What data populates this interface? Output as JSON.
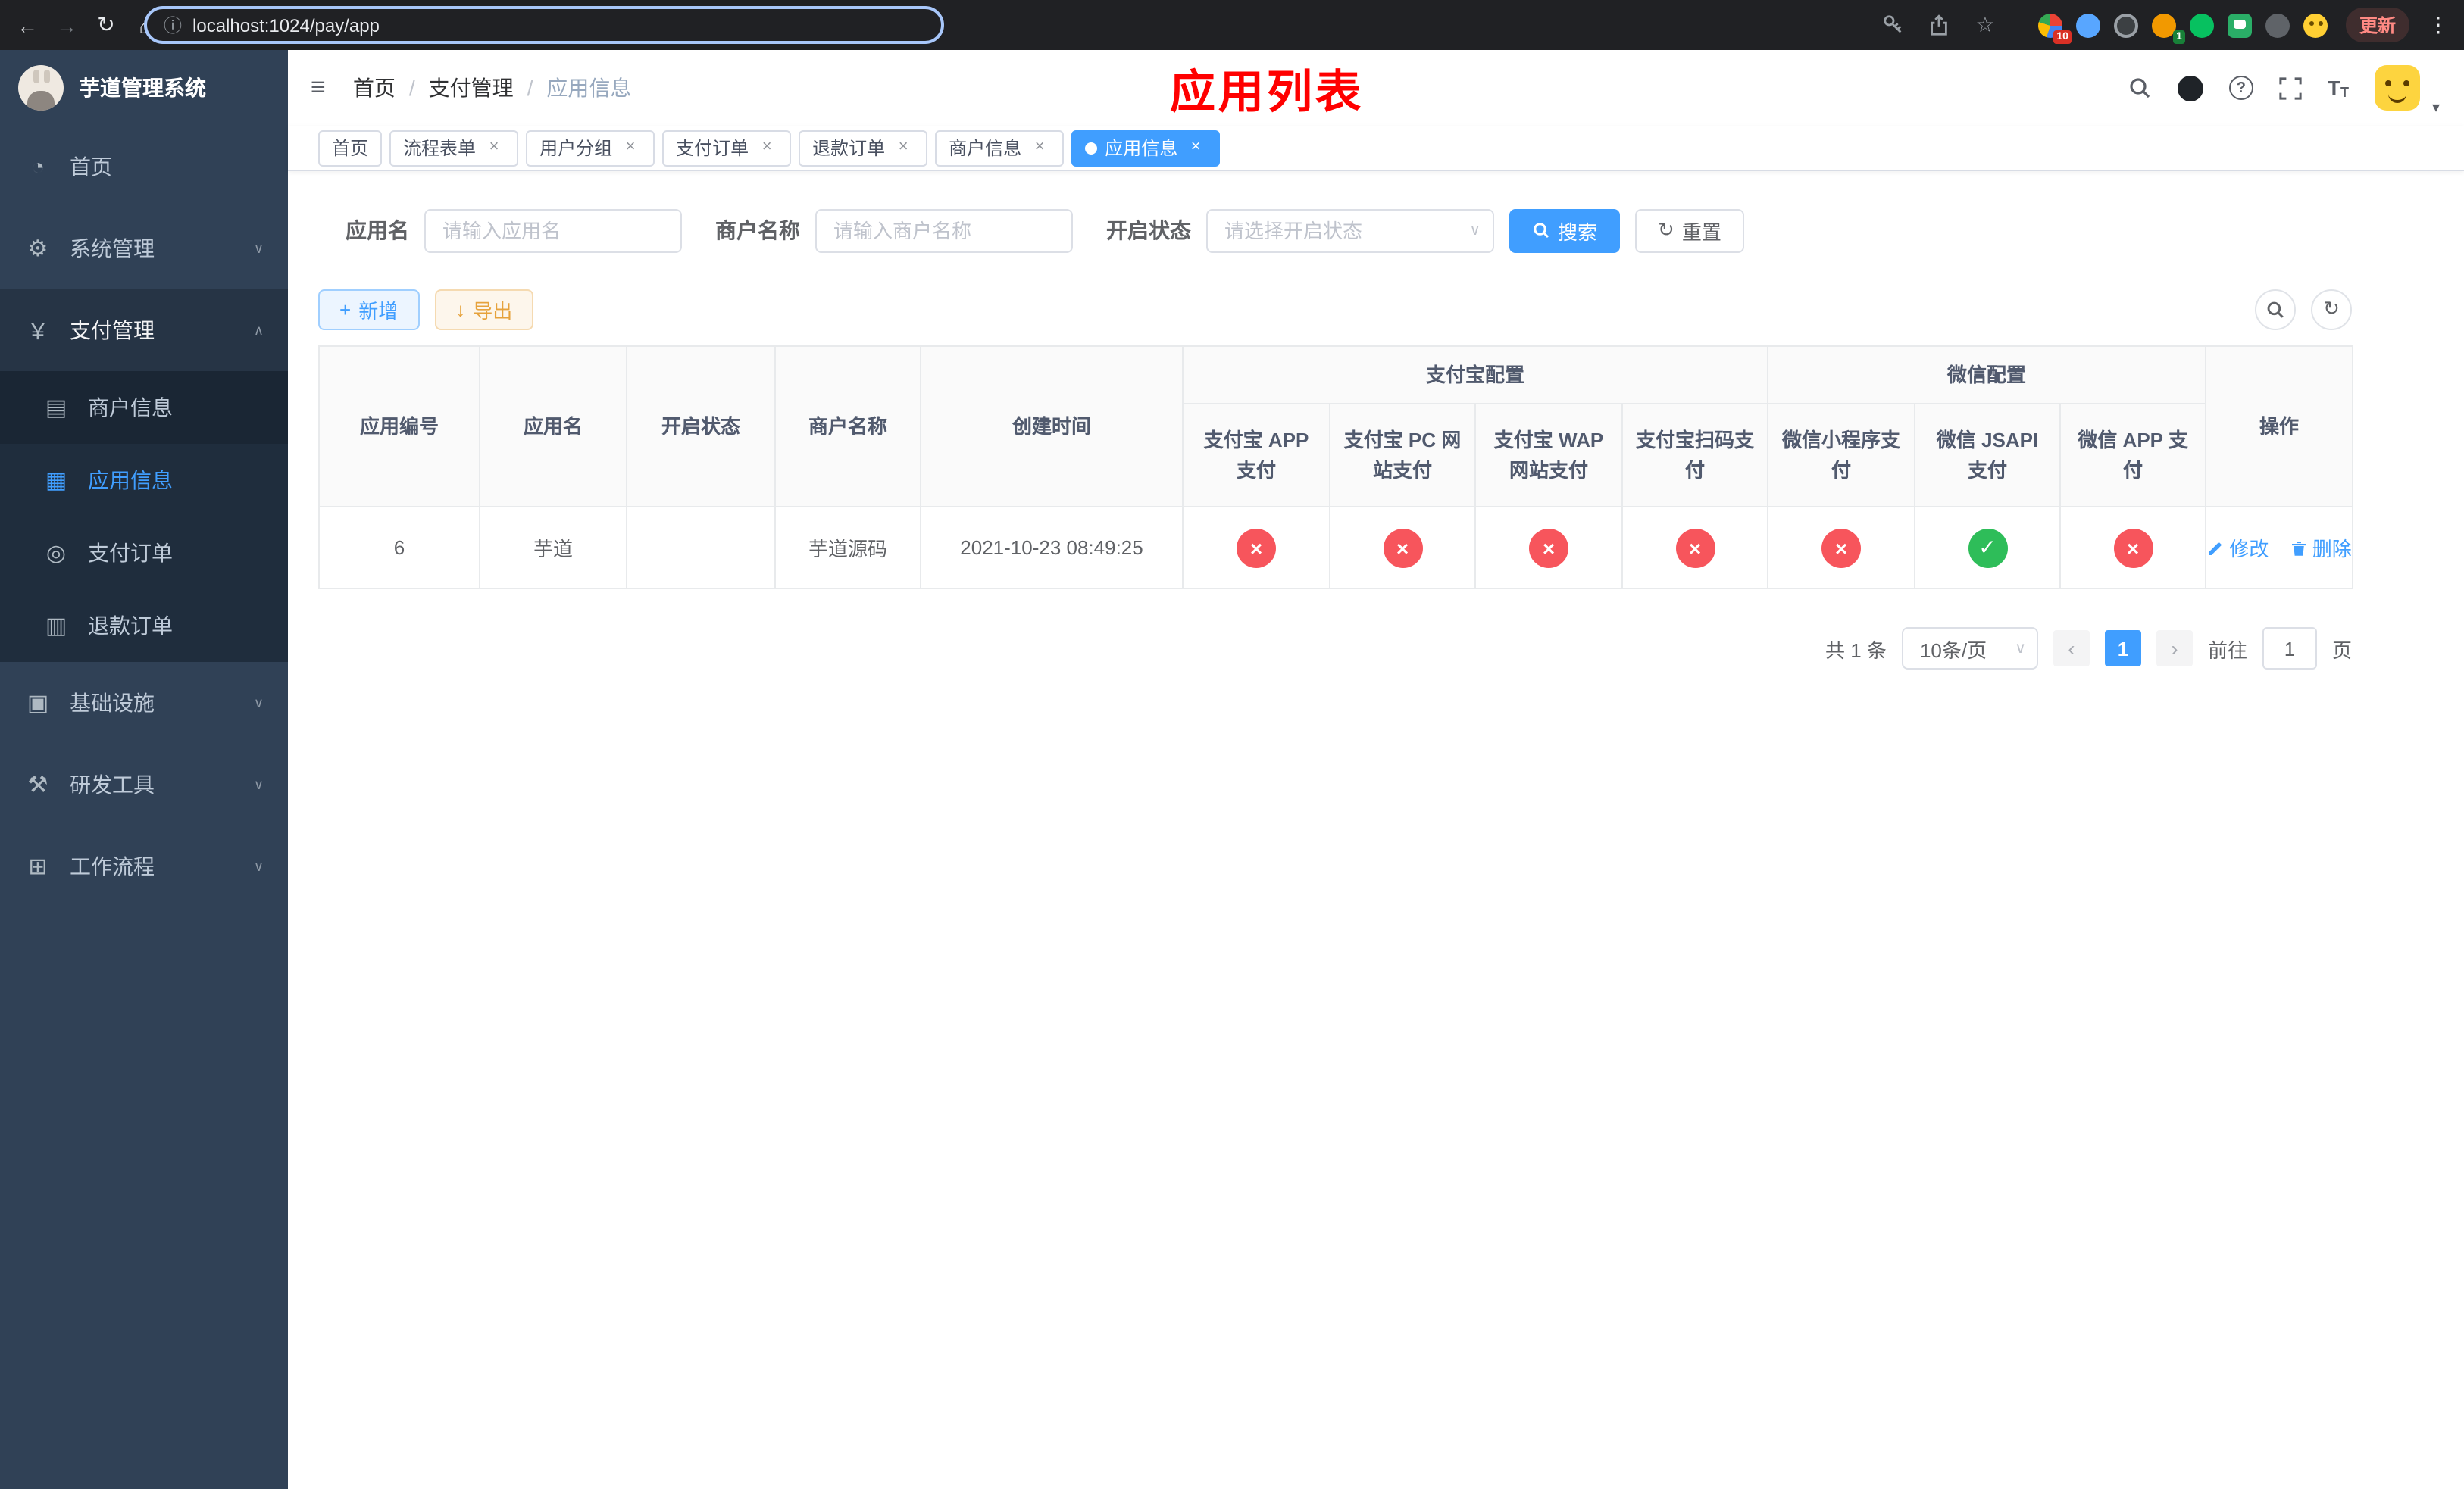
{
  "browser": {
    "url": "localhost:1024/pay/app",
    "update_label": "更新",
    "ext_badge_1": "10",
    "ext_badge_2": "1"
  },
  "icons": {
    "back": "←",
    "forward": "→",
    "reload": "↻",
    "home": "⌂",
    "info": "ⓘ",
    "star": "☆",
    "kebab": "⋮",
    "hamburger": "≡",
    "dashboard": "◔",
    "gear": "⚙",
    "yen": "￥",
    "card": "▤",
    "grid": "▦",
    "order": "◎",
    "doc": "▥",
    "infra": "▣",
    "tools": "⚒",
    "flow": "⊞",
    "chev_down": "∨",
    "chev_up": "∧",
    "caret_down": "▾",
    "plus": "+",
    "download": "↓",
    "refresh": "↻",
    "close": "×"
  },
  "sidebar": {
    "title": "芋道管理系统",
    "items": [
      {
        "label": "首页"
      },
      {
        "label": "系统管理"
      },
      {
        "label": "支付管理"
      },
      {
        "label": "商户信息"
      },
      {
        "label": "应用信息"
      },
      {
        "label": "支付订单"
      },
      {
        "label": "退款订单"
      },
      {
        "label": "基础设施"
      },
      {
        "label": "研发工具"
      },
      {
        "label": "工作流程"
      }
    ]
  },
  "header": {
    "breadcrumb": {
      "home": "首页",
      "section": "支付管理",
      "current": "应用信息"
    },
    "page_title": "应用列表"
  },
  "tabs": [
    {
      "label": "首页"
    },
    {
      "label": "流程表单"
    },
    {
      "label": "用户分组"
    },
    {
      "label": "支付订单"
    },
    {
      "label": "退款订单"
    },
    {
      "label": "商户信息"
    },
    {
      "label": "应用信息"
    }
  ],
  "filters": {
    "app_name_label": "应用名",
    "app_name_placeholder": "请输入应用名",
    "merchant_label": "商户名称",
    "merchant_placeholder": "请输入商户名称",
    "status_label": "开启状态",
    "status_placeholder": "请选择开启状态",
    "search_label": "搜索",
    "reset_label": "重置"
  },
  "toolbar": {
    "add_label": "新增",
    "export_label": "导出"
  },
  "table": {
    "columns": {
      "id": "应用编号",
      "name": "应用名",
      "status": "开启状态",
      "merchant": "商户名称",
      "created": "创建时间",
      "alipay_group": "支付宝配置",
      "wechat_group": "微信配置",
      "alipay_app": "支付宝 APP 支付",
      "alipay_pc": "支付宝 PC 网站支付",
      "alipay_wap": "支付宝 WAP 网站支付",
      "alipay_qr": "支付宝扫码支付",
      "wx_mini": "微信小程序支付",
      "wx_jsapi": "微信 JSAPI 支付",
      "wx_app": "微信 APP 支付",
      "ops": "操作"
    },
    "row": {
      "id": "6",
      "name": "芋道",
      "enabled": "true",
      "merchant": "芋道源码",
      "created": "2021-10-23 08:49:25",
      "configs": [
        {
          "state": "off",
          "glyph": "×"
        },
        {
          "state": "off",
          "glyph": "×"
        },
        {
          "state": "off",
          "glyph": "×"
        },
        {
          "state": "off",
          "glyph": "×"
        },
        {
          "state": "off",
          "glyph": "×"
        },
        {
          "state": "on",
          "glyph": "✓"
        },
        {
          "state": "off",
          "glyph": "×"
        }
      ],
      "edit_label": "修改",
      "delete_label": "删除"
    }
  },
  "pagination": {
    "total": "共 1 条",
    "page_size": "10条/页",
    "page": "1",
    "goto_label": "前往",
    "page_unit": "页",
    "goto_value": "1"
  },
  "colors": {
    "accent": "#409eff",
    "title_red": "#ff0000",
    "status_off": "#f7555c",
    "status_on": "#2ebd59",
    "sidebar_bg": "#304156",
    "submenu_bg": "#1f2d3d"
  }
}
